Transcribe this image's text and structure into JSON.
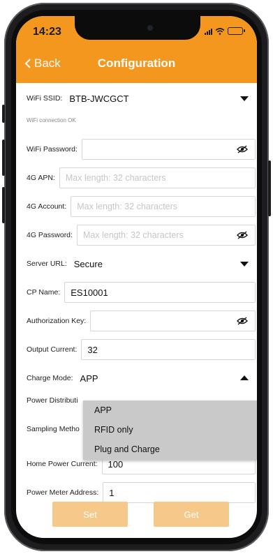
{
  "status_bar": {
    "time": "14:23"
  },
  "nav": {
    "back_label": "Back",
    "title": "Configuration"
  },
  "form": {
    "wifi_ssid": {
      "label": "WiFi SSID:",
      "value": "BTB-JWCGCT"
    },
    "wifi_status": "WiFi connection OK",
    "wifi_password": {
      "label": "WiFi Password:",
      "value": ""
    },
    "apn_4g": {
      "label": "4G APN:",
      "placeholder": "Max length: 32 characters"
    },
    "account_4g": {
      "label": "4G Account:",
      "placeholder": "Max length: 32 characters"
    },
    "password_4g": {
      "label": "4G Password:",
      "placeholder": "Max length: 32 characters"
    },
    "server_url": {
      "label": "Server URL:",
      "value": "Secure"
    },
    "cp_name": {
      "label": "CP Name:",
      "value": "ES10001"
    },
    "authorization_key": {
      "label": "Authorization Key:",
      "value": ""
    },
    "output_current": {
      "label": "Output Current:",
      "value": "32"
    },
    "charge_mode": {
      "label": "Charge Mode:",
      "value": "APP",
      "options": [
        "APP",
        "RFID only",
        "Plug and Charge"
      ]
    },
    "power_distribution": {
      "label": "Power Distributi"
    },
    "sampling_method": {
      "label": "Sampling Metho"
    },
    "home_power_current": {
      "label": "Home Power Current:",
      "value": "100"
    },
    "power_meter_address": {
      "label": "Power Meter Address:",
      "value": "1"
    }
  },
  "buttons": {
    "set_label": "Set",
    "get_label": "Get"
  },
  "colors": {
    "header": "#f4971f",
    "button": "#f6c98a"
  }
}
